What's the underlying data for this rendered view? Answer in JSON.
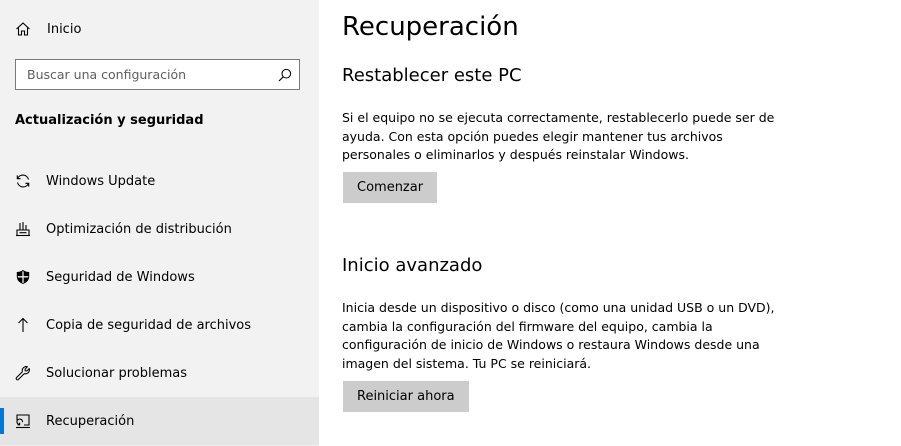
{
  "sidebar": {
    "home_label": "Inicio",
    "search": {
      "placeholder": "Buscar una configuración",
      "value": ""
    },
    "section_title": "Actualización y seguridad",
    "items": [
      {
        "label": "Windows Update",
        "icon": "sync-icon"
      },
      {
        "label": "Optimización de distribución",
        "icon": "delivery-optimization-icon"
      },
      {
        "label": "Seguridad de Windows",
        "icon": "shield-icon"
      },
      {
        "label": "Copia de seguridad de archivos",
        "icon": "upload-arrow-icon"
      },
      {
        "label": "Solucionar problemas",
        "icon": "wrench-icon"
      },
      {
        "label": "Recuperación",
        "icon": "recovery-icon",
        "active": true
      }
    ]
  },
  "main": {
    "title": "Recuperación",
    "reset": {
      "heading": "Restablecer este PC",
      "description": "Si el equipo no se ejecuta correctamente, restablecerlo puede ser de ayuda. Con esta opción puedes elegir mantener tus archivos personales o eliminarlos y después reinstalar Windows.",
      "button_label": "Comenzar"
    },
    "advanced": {
      "heading": "Inicio avanzado",
      "description": "Inicia desde un dispositivo o disco (como una unidad USB o un DVD), cambia la configuración del firmware del equipo, cambia la configuración de inicio de Windows o restaura Windows desde una imagen del sistema. Tu PC se reiniciará.",
      "button_label": "Reiniciar ahora"
    }
  },
  "colors": {
    "sidebar_bg": "#f2f2f2",
    "active_item_bg": "#e5e5e5",
    "accent": "#0078d7",
    "button_bg": "#cccccc"
  }
}
